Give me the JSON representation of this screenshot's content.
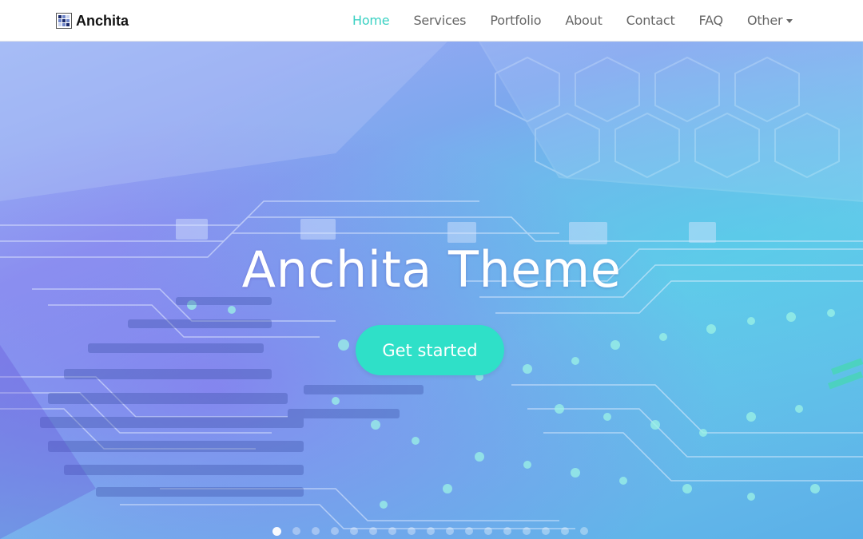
{
  "brand": {
    "name": "Anchita",
    "logo_icon": "pixel-grid-logo-icon"
  },
  "nav": {
    "items": [
      {
        "label": "Home",
        "active": true
      },
      {
        "label": "Services",
        "active": false
      },
      {
        "label": "Portfolio",
        "active": false
      },
      {
        "label": "About",
        "active": false
      },
      {
        "label": "Contact",
        "active": false
      },
      {
        "label": "FAQ",
        "active": false
      },
      {
        "label": "Other",
        "active": false,
        "dropdown": true,
        "icon": "caret-down-icon"
      }
    ]
  },
  "hero": {
    "title": "Anchita Theme",
    "cta_label": "Get started",
    "background_image": "circuit-board-image",
    "slide_count": 17,
    "active_slide": 1
  },
  "colors": {
    "accent": "#3ad1c3",
    "cta": "#2fe0c8",
    "nav_text": "#666666",
    "brand_text": "#111111"
  }
}
